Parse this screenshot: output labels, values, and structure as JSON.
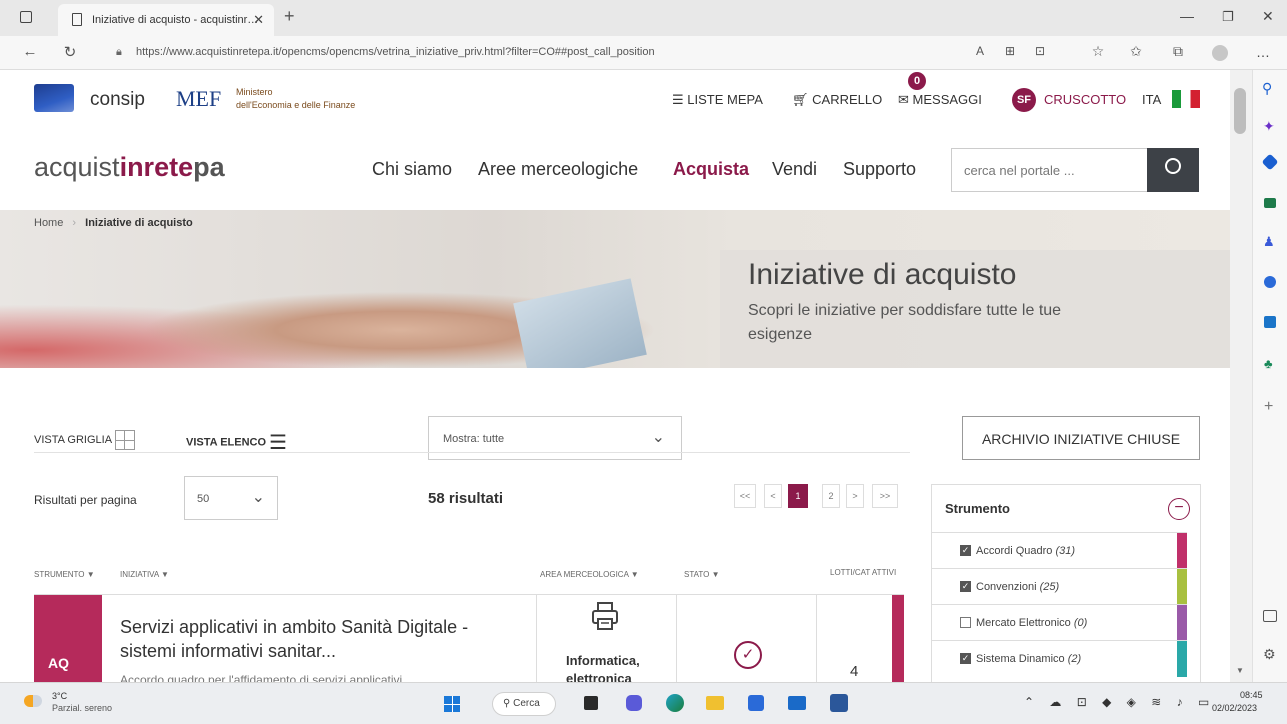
{
  "browser": {
    "tab_title": "Iniziative di acquisto - acquistinr…",
    "url": "https://www.acquistinretepa.it/opencms/opencms/vetrina_iniziative_priv.html?filter=CO##post_call_position",
    "more_label": "…"
  },
  "header": {
    "consip_label": "consip",
    "mef_label": "MEF",
    "mef_line1": "Ministero",
    "mef_line2": "dell'Economia e delle Finanze",
    "liste_mepa": "LISTE MEPA",
    "carrello": "CARRELLO",
    "messaggi": "MESSAGGI",
    "messages_count": "0",
    "avatar_initials": "SF",
    "cruscotto": "CRUSCOTTO",
    "language": "ITA"
  },
  "nav": {
    "logo_part1": "acquist",
    "logo_part2": "inrete",
    "logo_part3": "pa",
    "items": [
      "Chi siamo",
      "Aree merceologiche",
      "Acquista",
      "Vendi",
      "Supporto"
    ],
    "search_placeholder": "cerca nel portale ..."
  },
  "breadcrumb": {
    "home": "Home",
    "current": "Iniziative di acquisto"
  },
  "hero": {
    "title": "Iniziative di acquisto",
    "subtitle_line1": "Scopri le iniziative per soddisfare tutte le tue",
    "subtitle_line2": "esigenze"
  },
  "controls": {
    "grid_view": "VISTA GRIGLIA",
    "list_view": "VISTA ELENCO",
    "filter_select": "Mostra: tutte",
    "archive_button": "ARCHIVIO INIZIATIVE CHIUSE",
    "per_page_label": "Risultati per pagina",
    "per_page_value": "50",
    "results_count": "58 risultati"
  },
  "pagination": {
    "first": "<<",
    "prev": "<",
    "page1": "1",
    "page2": "2",
    "next": ">",
    "last": ">>"
  },
  "table": {
    "col_strumento": "STRUMENTO",
    "col_iniziativa": "INIZIATIVA",
    "col_area": "AREA MERCEOLOGICA",
    "col_stato": "STATO",
    "col_lotti": "LOTTI/CAT ATTIVI",
    "row1": {
      "badge": "AQ",
      "title_line1": "Servizi applicativi in ambito Sanità Digitale -",
      "title_line2": "sistemi informativi sanitar...",
      "desc": "Accordo quadro per l'affidamento di servizi applicativi",
      "area_line1": "Informatica,",
      "area_line2": "elettronica",
      "lots": "4"
    }
  },
  "sidebar": {
    "title": "Strumento",
    "items": [
      {
        "label": "Accordi Quadro",
        "count": "(31)",
        "checked": true,
        "color": "#c0306a"
      },
      {
        "label": "Convenzioni",
        "count": "(25)",
        "checked": true,
        "color": "#a8c040"
      },
      {
        "label": "Mercato Elettronico",
        "count": "(0)",
        "checked": false,
        "color": "#9a5aa8"
      },
      {
        "label": "Sistema Dinamico",
        "count": "(2)",
        "checked": true,
        "color": "#2aa8a8"
      }
    ]
  },
  "taskbar": {
    "weather_temp": "3°C",
    "weather_desc": "Parzial. sereno",
    "search_label": "Cerca",
    "time": "08:45",
    "date": "02/02/2023"
  },
  "colors": {
    "brand": "#8b1a4a",
    "accent_bar": "#b52a5b",
    "aq_badge": "#b52a5b",
    "search_btn": "#3d4147"
  }
}
